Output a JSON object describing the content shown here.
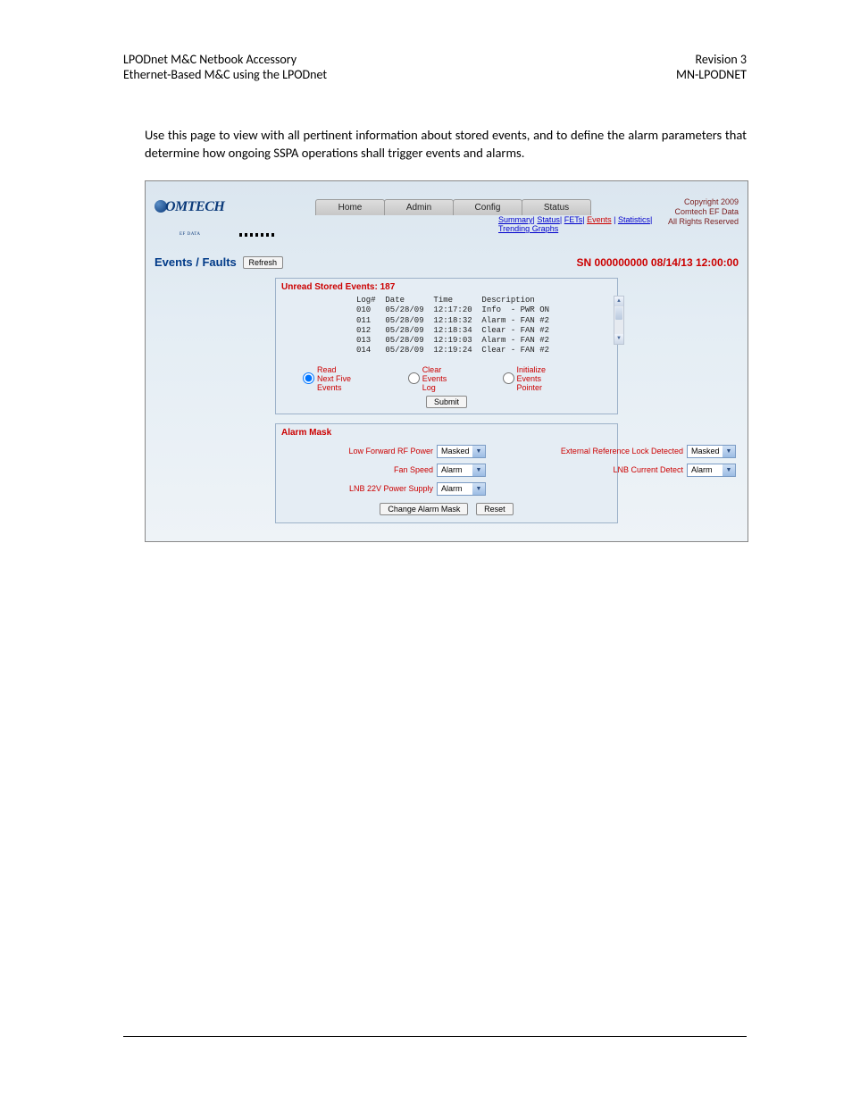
{
  "header": {
    "left1": "LPODnet M&C Netbook Accessory",
    "left2": "Ethernet-Based M&C using the LPODnet",
    "right1": "Revision 3",
    "right2": "MN-LPODNET"
  },
  "body": {
    "para": "Use this page to view with all pertinent information about stored events, and to define the alarm parameters that determine how ongoing SSPA operations shall trigger events and alarms."
  },
  "ui": {
    "logo_text": "OMTECH",
    "logo_sub": "EF DATA",
    "copyright": {
      "l1": "Copyright 2009",
      "l2": "Comtech EF Data",
      "l3": "All Rights Reserved"
    },
    "tabs": {
      "home": "Home",
      "admin": "Admin",
      "config": "Config",
      "status": "Status"
    },
    "subnav": {
      "summary": "Summary",
      "status": "Status",
      "fets": "FETs",
      "events": "Events",
      "statistics": "Statistics",
      "trending": "Trending Graphs"
    },
    "title": "Events / Faults",
    "refresh": "Refresh",
    "sn": "SN 000000000 08/14/13 12:00:00",
    "events_panel": {
      "title": "Unread Stored Events: 187",
      "log": "Log#  Date      Time      Description\n010   05/28/09  12:17:20  Info  - PWR ON\n011   05/28/09  12:18:32  Alarm - FAN #2\n012   05/28/09  12:18:34  Clear - FAN #2\n013   05/28/09  12:19:03  Alarm - FAN #2\n014   05/28/09  12:19:24  Clear - FAN #2",
      "radios": {
        "read_next": "Read Next Five Events",
        "clear_log": "Clear Events Log",
        "init_ptr": "Initialize Events Pointer"
      },
      "submit": "Submit"
    },
    "mask_panel": {
      "title": "Alarm Mask",
      "rows": {
        "low_rf": "Low Forward RF Power",
        "fan": "Fan Speed",
        "lnb22": "LNB 22V Power Supply",
        "extref": "External Reference Lock Detected",
        "lnbcur": "LNB Current Detect"
      },
      "values": {
        "low_rf": "Masked",
        "fan": "Alarm",
        "lnb22": "Alarm",
        "extref": "Masked",
        "lnbcur": "Alarm"
      },
      "change": "Change Alarm Mask",
      "reset": "Reset"
    }
  }
}
